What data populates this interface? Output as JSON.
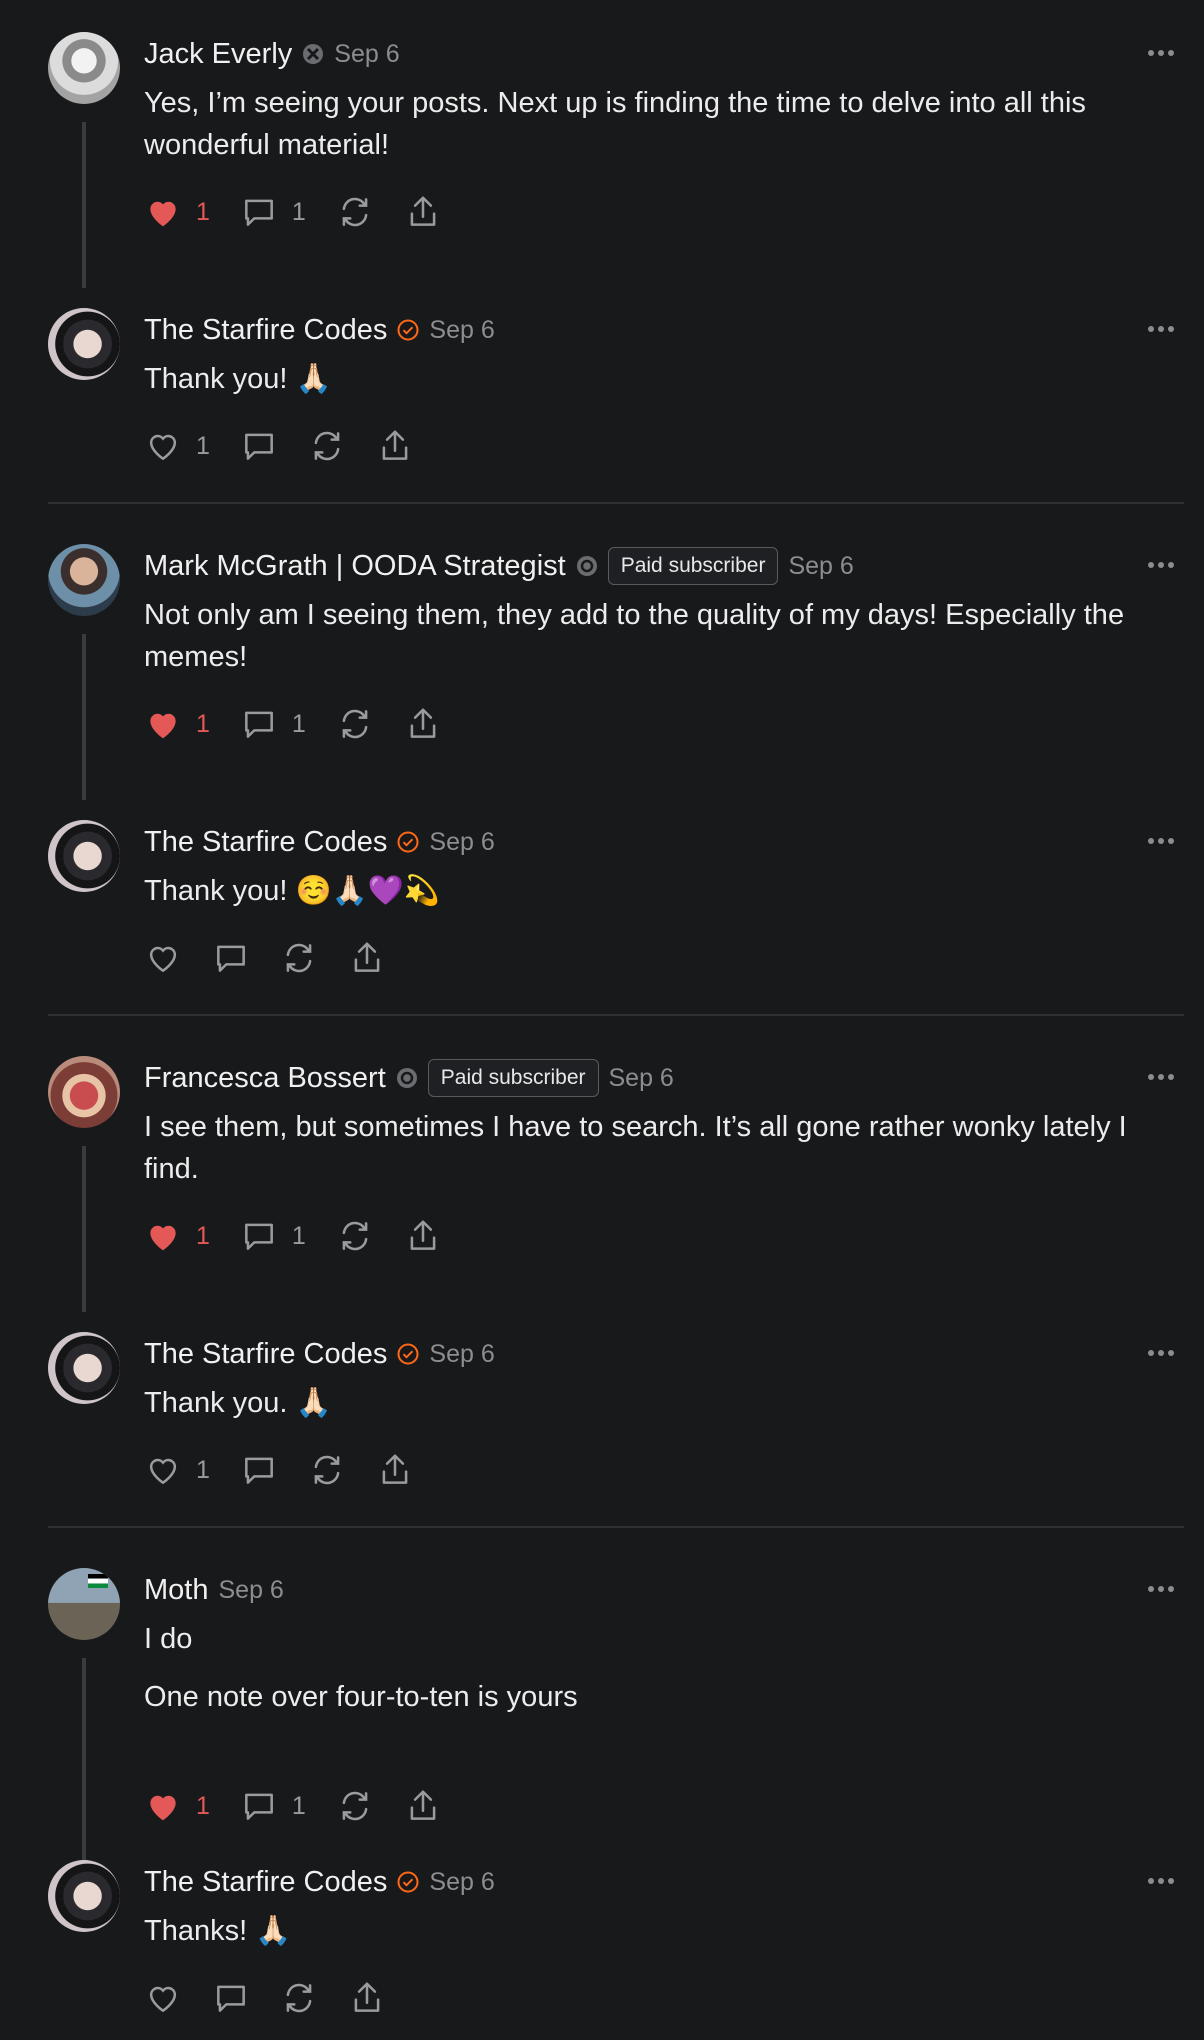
{
  "comments": [
    {
      "name": "Jack Everly",
      "date": "Sep 6",
      "text": [
        "Yes, I’m seeing your posts. Next up is finding the time to delve into all this wonderful material!"
      ],
      "likes": "1",
      "replies": "1"
    },
    {
      "name": "The Starfire Codes",
      "date": "Sep 6",
      "text": [
        "Thank you! 🙏🏻"
      ],
      "likes": "1"
    },
    {
      "name": "Mark McGrath | OODA Strategist",
      "badge": "Paid subscriber",
      "date": "Sep 6",
      "text": [
        "Not only am I seeing them, they add to the quality of my days! Especially the memes!"
      ],
      "likes": "1",
      "replies": "1"
    },
    {
      "name": "The Starfire Codes",
      "date": "Sep 6",
      "text": [
        "Thank you! ☺️🙏🏻💜💫"
      ]
    },
    {
      "name": "Francesca Bossert",
      "badge": "Paid subscriber",
      "date": "Sep 6",
      "text": [
        "I see them, but sometimes I have to search. It’s all gone rather wonky lately I find."
      ],
      "likes": "1",
      "replies": "1"
    },
    {
      "name": "The Starfire Codes",
      "date": "Sep 6",
      "text": [
        "Thank you. 🙏🏻"
      ],
      "likes": "1"
    },
    {
      "name": "Moth",
      "date": "Sep 6",
      "text": [
        "I do",
        "One note over four-to-ten is yours"
      ],
      "likes": "1",
      "replies": "1"
    },
    {
      "name": "The Starfire Codes",
      "date": "Sep 6",
      "text": [
        "Thanks! 🙏🏻"
      ]
    }
  ],
  "colors": {
    "liked": "#e45858",
    "verified": "#ff6719",
    "muted": "#8c8d91"
  }
}
